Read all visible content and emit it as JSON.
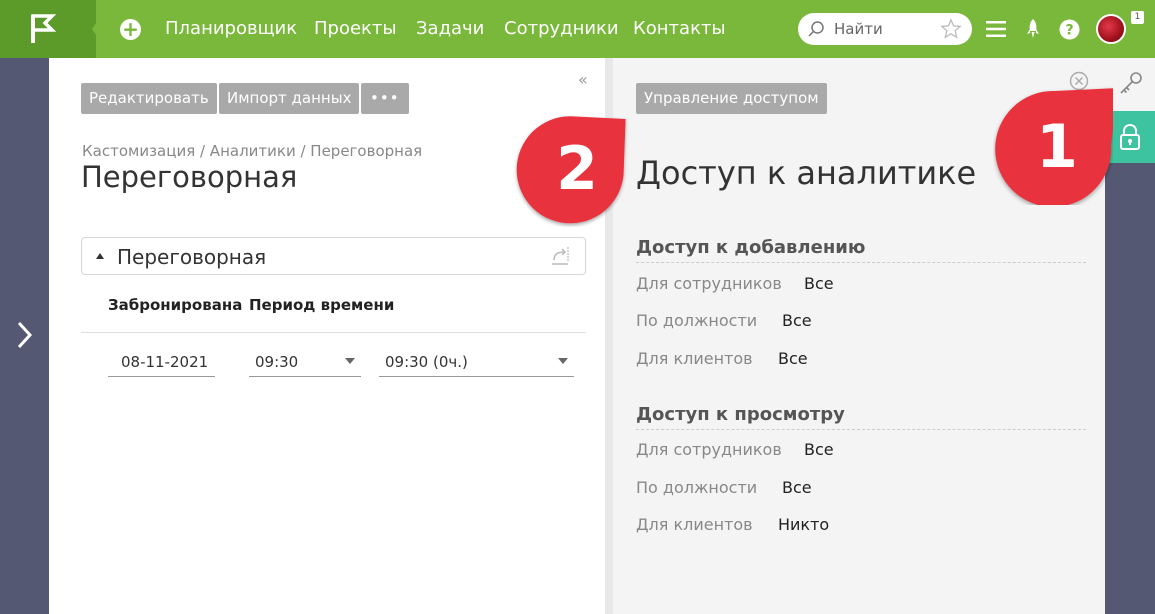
{
  "topnav": {
    "items": [
      "Планировщик",
      "Проекты",
      "Задачи",
      "Сотрудники",
      "Контакты"
    ],
    "search_placeholder": "Найти",
    "notification_count": "1"
  },
  "toolbar": {
    "edit_label": "Редактировать",
    "import_label": "Импорт данных",
    "more_label": "•••",
    "collapse_label": "«"
  },
  "main": {
    "breadcrumb": "Кастомизация / Аналитики / Переговорная",
    "title": "Переговорная",
    "section_title": "Переговорная",
    "columns": [
      "Забронирована",
      "Период времени"
    ],
    "row": {
      "date": "08-11-2021",
      "time_from": "09:30",
      "time_to": "09:30 (0ч.)"
    }
  },
  "access": {
    "manage_label": "Управление доступом",
    "title": "Доступ к аналитике",
    "add": {
      "heading": "Доступ к добавлению",
      "rows": [
        {
          "label": "Для сотрудников",
          "value": "Все"
        },
        {
          "label": "По должности",
          "value": "Все"
        },
        {
          "label": "Для клиентов",
          "value": "Все"
        }
      ]
    },
    "view": {
      "heading": "Доступ к просмотру",
      "rows": [
        {
          "label": "Для сотрудников",
          "value": "Все"
        },
        {
          "label": "По должности",
          "value": "Все"
        },
        {
          "label": "Для клиентов",
          "value": "Никто"
        }
      ]
    }
  },
  "callouts": [
    "1",
    "2"
  ],
  "colors": {
    "topbar": "#7ab83b",
    "rail": "#545872",
    "lock_tab": "#3ec3a0",
    "callout": "#e8323c"
  }
}
